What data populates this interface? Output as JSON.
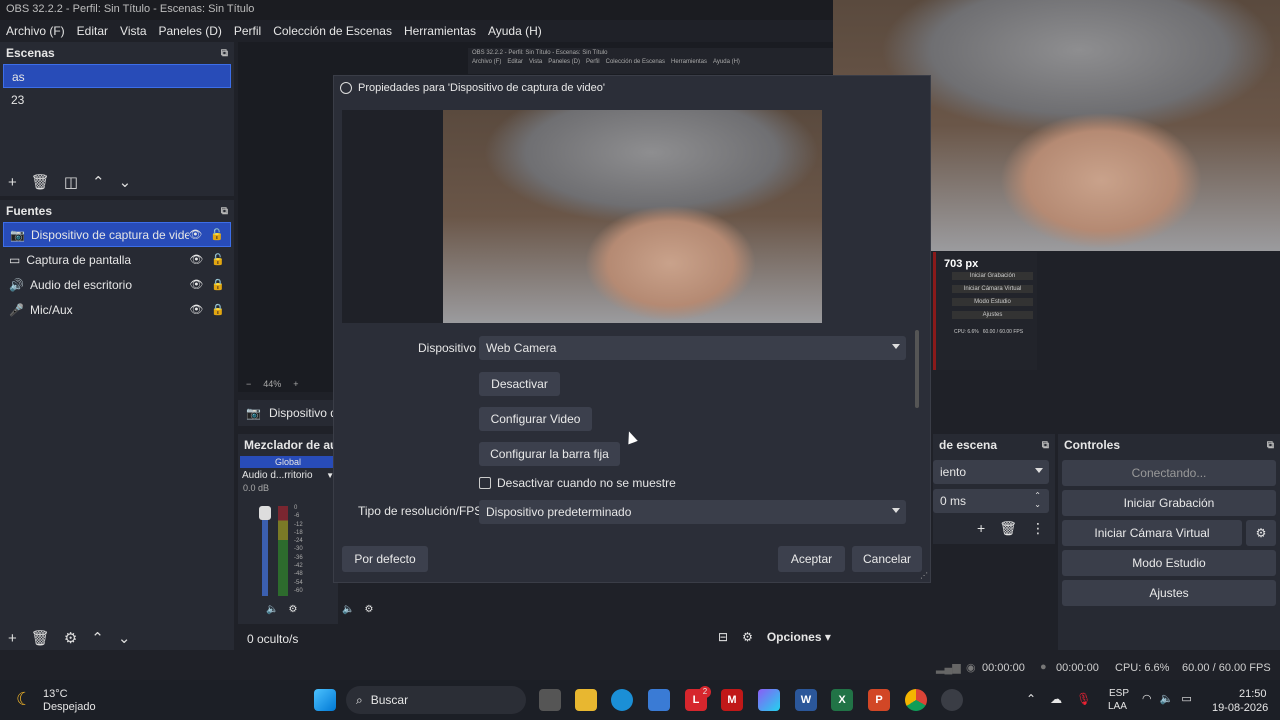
{
  "window": {
    "title": "OBS 32.2.2 - Perfil: Sin Título - Escenas: Sin Título"
  },
  "menu": [
    "Archivo (F)",
    "Editar",
    "Vista",
    "Paneles (D)",
    "Perfil",
    "Colección de Escenas",
    "Herramientas",
    "Ayuda (H)"
  ],
  "scenes": {
    "title": "Escenas",
    "items": [
      "as",
      "23"
    ]
  },
  "sources": {
    "title": "Fuentes",
    "items": [
      "Dispositivo de captura de video",
      "Captura de pantalla",
      "Audio del escritorio",
      "Mic/Aux"
    ]
  },
  "dialog": {
    "title": "Propiedades para 'Dispositivo de captura de video'",
    "device_label": "Dispositivo",
    "device_value": "Web Camera",
    "deactivate_btn": "Desactivar",
    "config_video_btn": "Configurar Video",
    "config_bar_btn": "Configurar la barra fija",
    "hide_checkbox_label": "Desactivar cuando no se muestre",
    "resolution_label": "Tipo de resolución/FPS",
    "resolution_value": "Dispositivo predeterminado",
    "defaults_btn": "Por defecto",
    "accept_btn": "Aceptar",
    "cancel_btn": "Cancelar"
  },
  "preview": {
    "zoom": "44%",
    "source_label": "Dispositivo d",
    "size_label": "703 px"
  },
  "mixer": {
    "title": "Mezclador de au",
    "global_tab": "Global",
    "channel": "Audio d...rritorio",
    "db": "0.0 dB",
    "scale": [
      "0",
      "-6",
      "-12",
      "-18",
      "-24",
      "-30",
      "-36",
      "-42",
      "-48",
      "-54",
      "-60"
    ]
  },
  "transitions": {
    "title": "de escena",
    "value1": "iento",
    "value2": "0 ms"
  },
  "controls": {
    "title": "Controles",
    "connecting": "Conectando...",
    "start_recording": "Iniciar Grabación",
    "start_virtual_cam": "Iniciar Cámara Virtual",
    "studio_mode": "Modo Estudio",
    "settings": "Ajustes"
  },
  "bottom": {
    "hidden_count": "0 oculto/s",
    "options": "Opciones"
  },
  "mini_obs": {
    "menu": [
      "Archivo (F)",
      "Editar",
      "Vista",
      "Paneles (D)",
      "Perfil",
      "Colección de Escenas",
      "Herramientas",
      "Ayuda (H)"
    ],
    "buttons": [
      "Iniciar Grabación",
      "Iniciar Cámara Virtual",
      "Modo Estudio",
      "Ajustes"
    ],
    "cpu": "CPU: 6.6%",
    "fps": "60.00 / 60.00 FPS"
  },
  "status": {
    "time1": "00:00:00",
    "time2": "00:00:00",
    "cpu": "CPU: 6.6%",
    "fps": "60.00 / 60.00 FPS"
  },
  "taskbar": {
    "temp": "13°C",
    "weather": "Despejado",
    "search": "Buscar",
    "lang1": "ESP",
    "lang2": "LAA",
    "time": "21:50",
    "date": "19-08-2026",
    "badge": "2"
  }
}
